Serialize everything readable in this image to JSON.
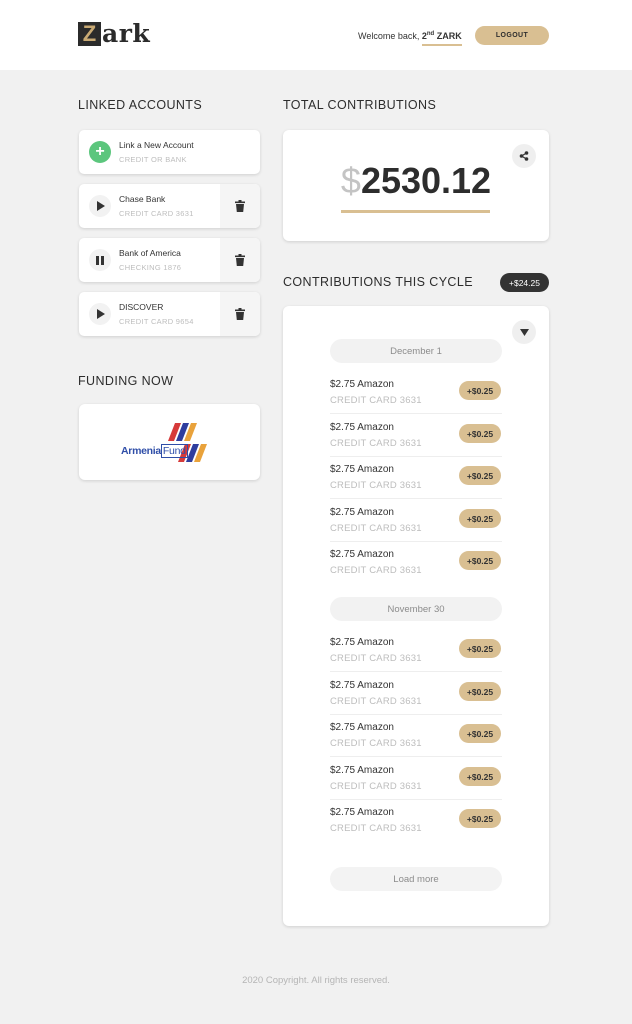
{
  "header": {
    "logo_initial": "Z",
    "logo_rest": "ark",
    "welcome_text": "Welcome back, ",
    "user_prefix": "2",
    "user_sup": "nd",
    "user_name": " ZARK",
    "logout_label": "LOGOUT"
  },
  "linked_accounts": {
    "title": "LINKED ACCOUNTS",
    "add": {
      "name": "Link a New Account",
      "sub": "CREDIT OR BANK"
    },
    "items": [
      {
        "name": "Chase Bank",
        "sub": "CREDIT CARD 3631",
        "state": "play"
      },
      {
        "name": "Bank of America",
        "sub": "CHECKING 1876",
        "state": "pause"
      },
      {
        "name": "DISCOVER",
        "sub": "CREDIT CARD 9654",
        "state": "play"
      }
    ]
  },
  "funding": {
    "title": "FUNDING NOW",
    "logo_text_a": "Armenia",
    "logo_text_b": "Fund"
  },
  "totals": {
    "title": "TOTAL CONTRIBUTIONS",
    "currency": "$",
    "amount": "2530.12"
  },
  "cycle": {
    "title": "CONTRIBUTIONS THIS CYCLE",
    "badge": "+$24.25",
    "groups": [
      {
        "date": "December 1",
        "items": [
          {
            "title": "$2.75 Amazon",
            "sub": "CREDIT CARD 3631",
            "amount": "+$0.25"
          },
          {
            "title": "$2.75 Amazon",
            "sub": "CREDIT CARD 3631",
            "amount": "+$0.25"
          },
          {
            "title": "$2.75 Amazon",
            "sub": "CREDIT CARD 3631",
            "amount": "+$0.25"
          },
          {
            "title": "$2.75 Amazon",
            "sub": "CREDIT CARD 3631",
            "amount": "+$0.25"
          },
          {
            "title": "$2.75 Amazon",
            "sub": "CREDIT CARD 3631",
            "amount": "+$0.25"
          }
        ]
      },
      {
        "date": "November 30",
        "items": [
          {
            "title": "$2.75 Amazon",
            "sub": "CREDIT CARD 3631",
            "amount": "+$0.25"
          },
          {
            "title": "$2.75 Amazon",
            "sub": "CREDIT CARD 3631",
            "amount": "+$0.25"
          },
          {
            "title": "$2.75 Amazon",
            "sub": "CREDIT CARD 3631",
            "amount": "+$0.25"
          },
          {
            "title": "$2.75 Amazon",
            "sub": "CREDIT CARD 3631",
            "amount": "+$0.25"
          },
          {
            "title": "$2.75 Amazon",
            "sub": "CREDIT CARD 3631",
            "amount": "+$0.25"
          }
        ]
      }
    ],
    "load_more": "Load more"
  },
  "footer": {
    "copyright": "2020 Copyright. All rights reserved."
  },
  "colors": {
    "accent": "#d9bf92",
    "add_green": "#5cc67d",
    "dark": "#333333",
    "background": "#f1f1f1"
  },
  "icons": [
    "plus-icon",
    "play-icon",
    "pause-icon",
    "trash-icon",
    "share-icon",
    "triangle-down-icon"
  ]
}
